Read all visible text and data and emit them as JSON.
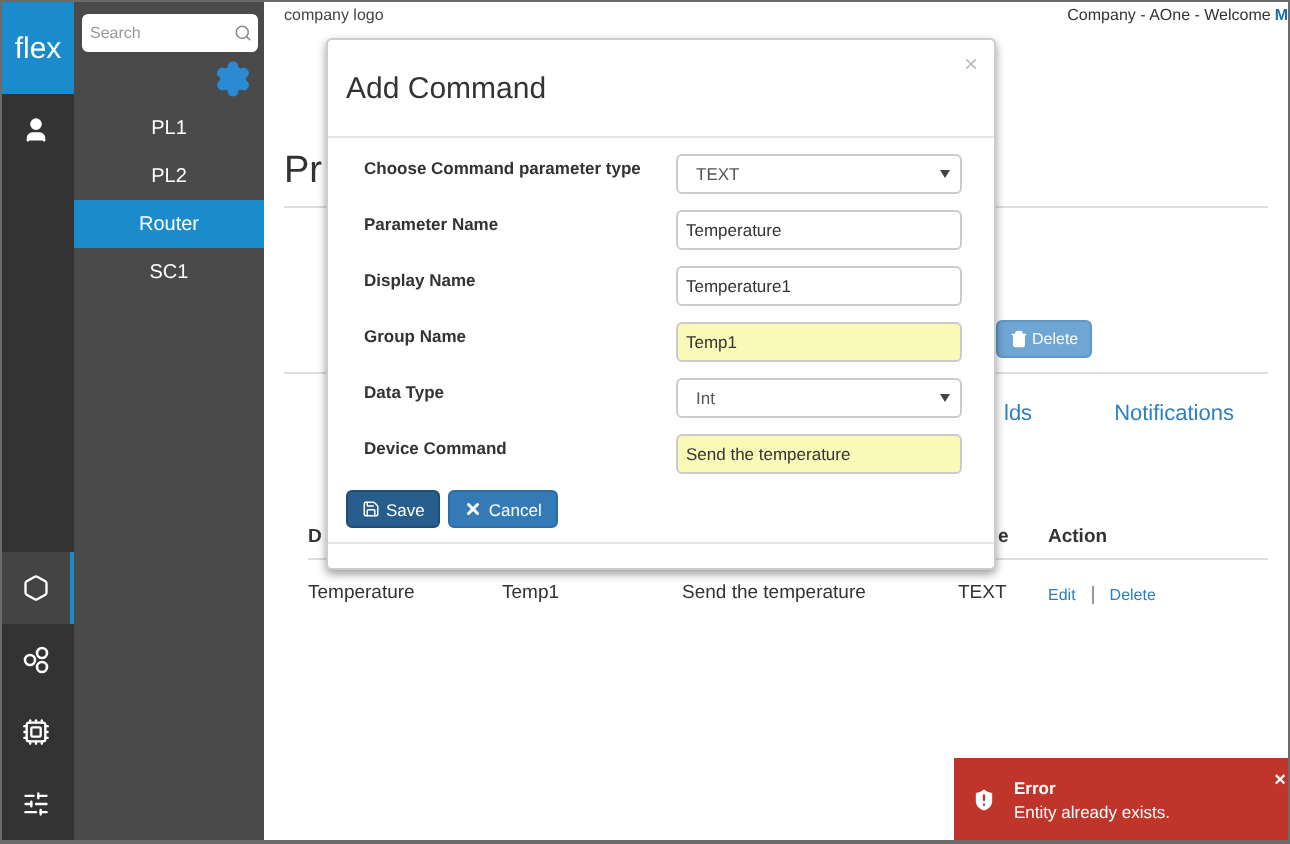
{
  "rail": {
    "logo": "flex",
    "items": [
      {
        "kind": "user",
        "selected": false
      },
      {
        "kind": "hexagon",
        "selected": true
      },
      {
        "kind": "circles",
        "selected": false
      },
      {
        "kind": "chip",
        "selected": false
      },
      {
        "kind": "sliders",
        "selected": false
      }
    ]
  },
  "sidebar": {
    "search": {
      "placeholder": "Search"
    },
    "items": [
      {
        "label": "PL1",
        "selected": false
      },
      {
        "label": "PL2",
        "selected": false
      },
      {
        "label": "Router",
        "selected": true
      },
      {
        "label": "SC1",
        "selected": false
      }
    ]
  },
  "header": {
    "logo_text": "company logo",
    "welcome": "Company - AOne - Welcome",
    "user": "M"
  },
  "page": {
    "heading": "Pr",
    "delete_button": "Delete",
    "tabs": [
      {
        "label": "lds"
      },
      {
        "label": "Notifications"
      }
    ],
    "table": {
      "columns": [
        "D",
        "",
        "",
        "e",
        "Action"
      ],
      "rows": [
        {
          "cells": [
            "Temperature",
            "Temp1",
            "Send the temperature",
            "TEXT"
          ],
          "actions": [
            "Edit",
            "Delete"
          ]
        }
      ]
    }
  },
  "dialog": {
    "title": "Add Command",
    "close": "×",
    "fields": [
      {
        "label": "Choose Command parameter type",
        "kind": "select",
        "value": "TEXT",
        "highlighted": false
      },
      {
        "label": "Parameter Name",
        "kind": "text",
        "value": "Temperature",
        "highlighted": false
      },
      {
        "label": "Display Name",
        "kind": "text",
        "value": "Temperature1",
        "highlighted": false
      },
      {
        "label": "Group Name",
        "kind": "text",
        "value": "Temp1",
        "highlighted": true
      },
      {
        "label": "Data Type",
        "kind": "select",
        "value": "Int",
        "highlighted": false
      },
      {
        "label": "Device Command",
        "kind": "text",
        "value": "Send the temperature",
        "highlighted": true
      }
    ],
    "buttons": [
      {
        "label": "Save",
        "kind": "save"
      },
      {
        "label": "Cancel",
        "kind": "cancel"
      }
    ]
  },
  "toast": {
    "title": "Error",
    "message": "Entity already exists.",
    "close": "×"
  }
}
